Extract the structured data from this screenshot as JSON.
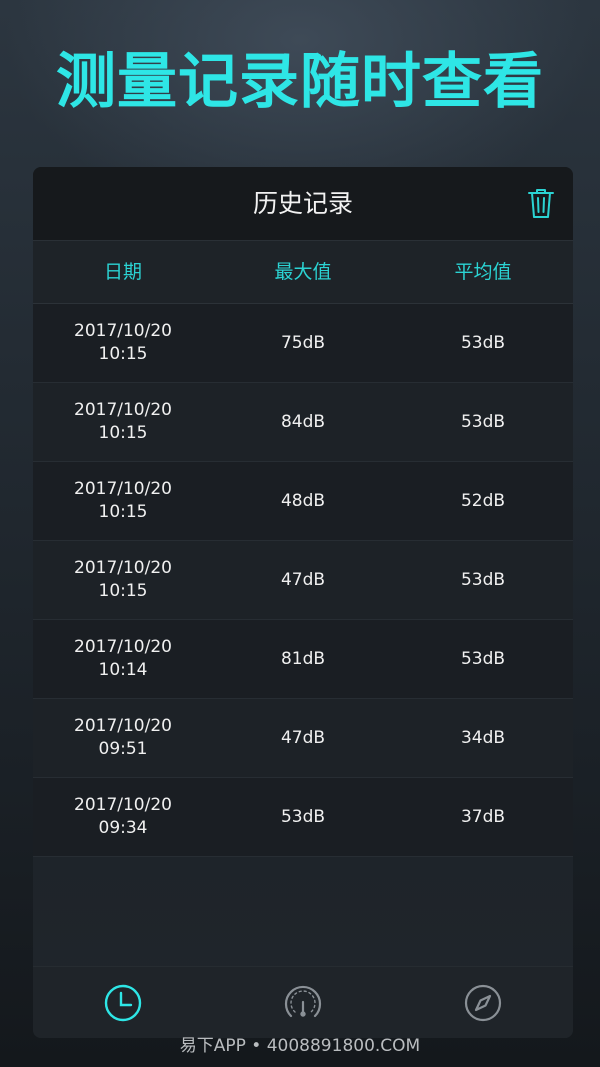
{
  "headline": "测量记录随时查看",
  "panel": {
    "title": "历史记录"
  },
  "columns": {
    "date": "日期",
    "max": "最大值",
    "avg": "平均值"
  },
  "records": [
    {
      "date": "2017/10/20",
      "time": "10:15",
      "max": "75dB",
      "avg": "53dB"
    },
    {
      "date": "2017/10/20",
      "time": "10:15",
      "max": "84dB",
      "avg": "53dB"
    },
    {
      "date": "2017/10/20",
      "time": "10:15",
      "max": "48dB",
      "avg": "52dB"
    },
    {
      "date": "2017/10/20",
      "time": "10:15",
      "max": "47dB",
      "avg": "53dB"
    },
    {
      "date": "2017/10/20",
      "time": "10:14",
      "max": "81dB",
      "avg": "53dB"
    },
    {
      "date": "2017/10/20",
      "time": "09:51",
      "max": "47dB",
      "avg": "34dB"
    },
    {
      "date": "2017/10/20",
      "time": "09:34",
      "max": "53dB",
      "avg": "37dB"
    }
  ],
  "tabs": [
    {
      "icon": "clock-icon",
      "active": true
    },
    {
      "icon": "gauge-icon",
      "active": false
    },
    {
      "icon": "compass-icon",
      "active": false
    }
  ],
  "watermark": "易下APP • 4008891800.COM",
  "colors": {
    "accent": "#2ee6e6",
    "accent_dim": "#2bd3d3",
    "icon_inactive": "#8a9096"
  }
}
